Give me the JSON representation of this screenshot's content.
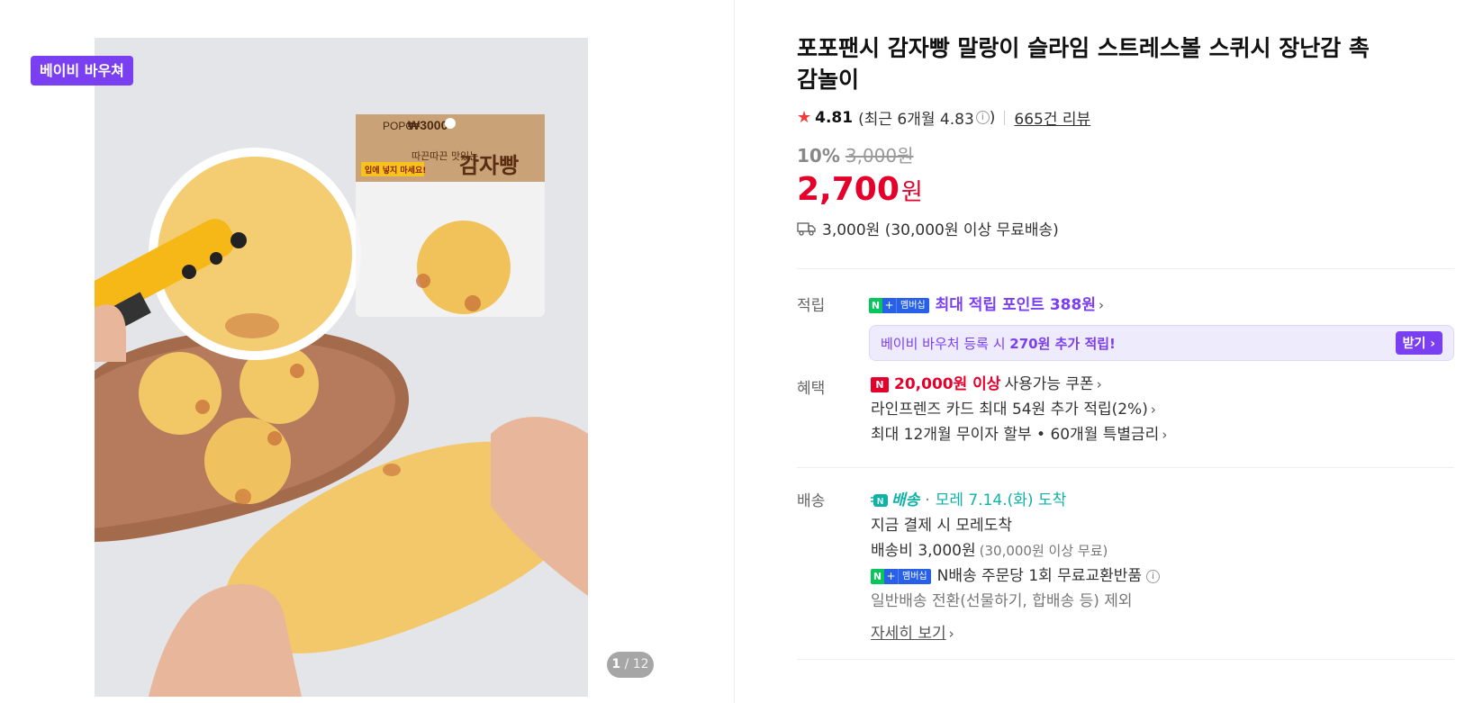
{
  "gallery": {
    "voucher_badge": "베이비 바우쳐",
    "counter_current": "1",
    "counter_total": "/ 12",
    "package_price": "₩3000",
    "package_brand": "POPO",
    "package_slogan": "따끈따끈 맛있는",
    "package_name": "감자빵",
    "package_warning": "입에 넣지 마세요!"
  },
  "product": {
    "title": "포포팬시 감자빵 말랑이 슬라임 스트레스볼 스퀴시 장난감 촉감놀이",
    "rating": "4.81",
    "recent_rating": "(최근 6개월 4.83",
    "recent_rating_close": ")",
    "reviews": "665건 리뷰",
    "discount": "10%",
    "original_price": "3,000원",
    "price": "2,700",
    "won": "원",
    "shipping": "3,000원 (30,000원 이상 무료배송)"
  },
  "reward": {
    "label": "적립",
    "badge_n": "N",
    "badge_plus": "+",
    "badge_member": "멤버십",
    "points_text": "최대 적립 포인트 388원",
    "voucher_prefix": "베이비 바우처 등록 시 ",
    "voucher_bold": "270원 추가",
    "voucher_suffix": " 적립!",
    "get_button": "받기"
  },
  "benefit": {
    "label": "혜택",
    "coupon_badge": "N",
    "coupon_bold": "20,000원 이상",
    "coupon_text": "사용가능 쿠폰",
    "card_text": "라인프렌즈 카드 최대 54원 추가 적립(2%)",
    "installment_text": "최대 12개월 무이자 할부 • 60개월 특별금리"
  },
  "delivery": {
    "label": "배송",
    "n_delivery": "배송",
    "dot": "·",
    "arrival": "모레 7.14.(화) 도착",
    "pay_now": "지금 결제 시 모레도착",
    "fee": "배송비 3,000원",
    "fee_note": "(30,000원 이상 무료)",
    "exchange": "N배송 주문당 1회 무료교환반품",
    "exception": "일반배송 전환(선물하기, 합배송 등) 제외",
    "more": "자세히 보기"
  },
  "colors": {
    "accent_purple": "#7b3ff2",
    "price_red": "#e4002b",
    "delivery_teal": "#0fb3a6",
    "naver_green": "#03c75a"
  }
}
